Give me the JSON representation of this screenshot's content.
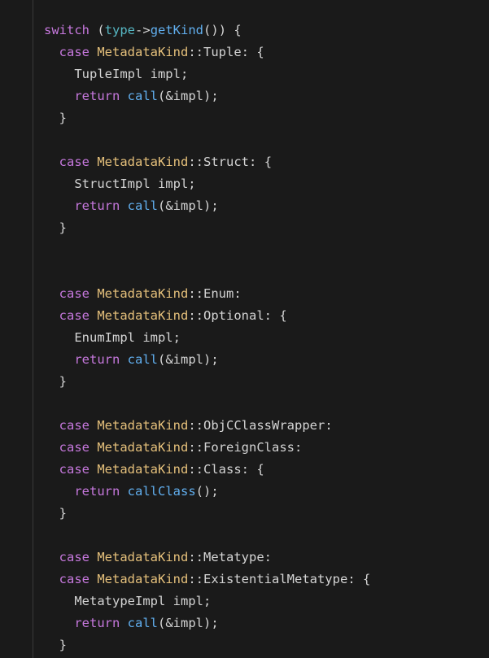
{
  "code": {
    "kw_switch": "switch",
    "kw_case": "case",
    "kw_return": "return",
    "type_var": "type",
    "arrow": "->",
    "fn_getKind": "getKind",
    "fn_call": "call",
    "fn_callClass": "callClass",
    "cls_MetadataKind": "MetadataKind",
    "scope": "::",
    "labels": {
      "Tuple": "Tuple",
      "Struct": "Struct",
      "Enum": "Enum",
      "Optional": "Optional",
      "ObjCClassWrapper": "ObjCClassWrapper",
      "ForeignClass": "ForeignClass",
      "Class": "Class",
      "Metatype": "Metatype",
      "ExistentialMetatype": "ExistentialMetatype"
    },
    "decl": {
      "TupleImpl": "TupleImpl impl;",
      "StructImpl": "StructImpl impl;",
      "EnumImpl": "EnumImpl impl;",
      "MetatypeImpl": "MetatypeImpl impl;"
    },
    "amp_impl": "(&impl);",
    "empty_parens": "();",
    "open_paren": "(",
    "close_paren": ")",
    "open_brace": "{",
    "close_brace": "}",
    "colon": ":",
    "space": " "
  }
}
